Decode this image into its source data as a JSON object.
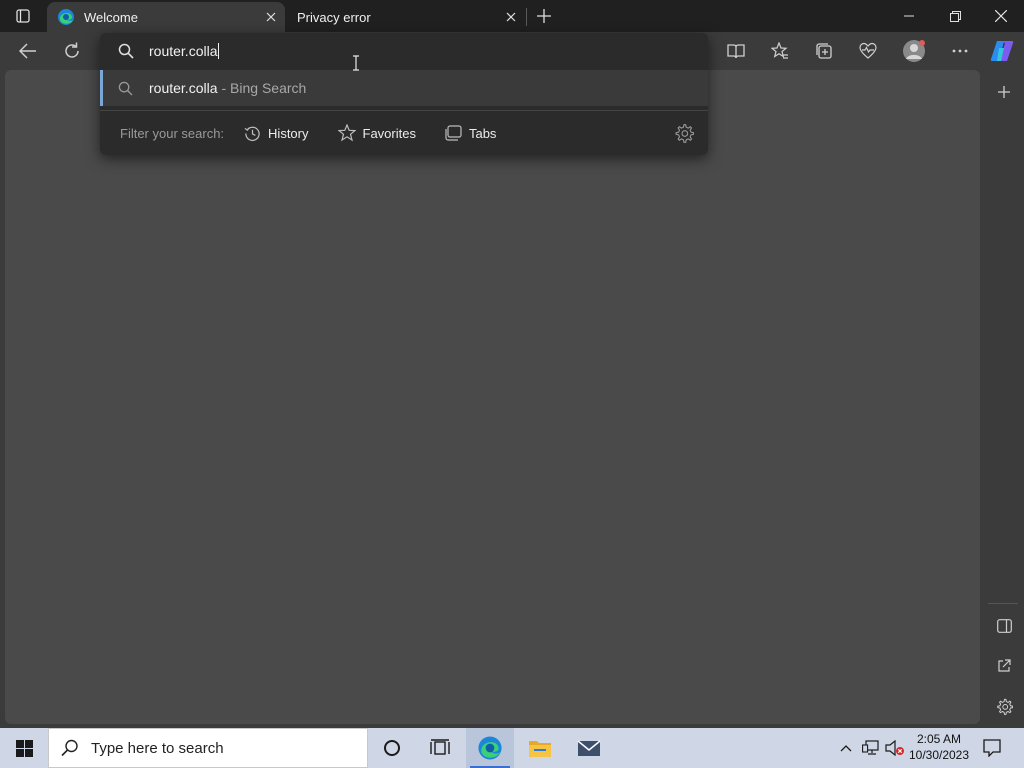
{
  "browser": {
    "tabs": [
      {
        "label": "Welcome",
        "active": true
      },
      {
        "label": "Privacy error",
        "active": false
      }
    ]
  },
  "omnibox": {
    "value": "router.colla",
    "suggestion": {
      "text": "router.colla",
      "suffix": "- Bing Search"
    },
    "filter": {
      "label": "Filter your search:",
      "options": [
        "History",
        "Favorites",
        "Tabs"
      ]
    }
  },
  "taskbar": {
    "search_placeholder": "Type here to search",
    "time": "2:05 AM",
    "date": "10/30/2023"
  },
  "colors": {
    "accent": "#7aa7d8",
    "background": "#3b3b3b",
    "content": "#4a4a4a",
    "taskbar": "#cfd7e6"
  }
}
